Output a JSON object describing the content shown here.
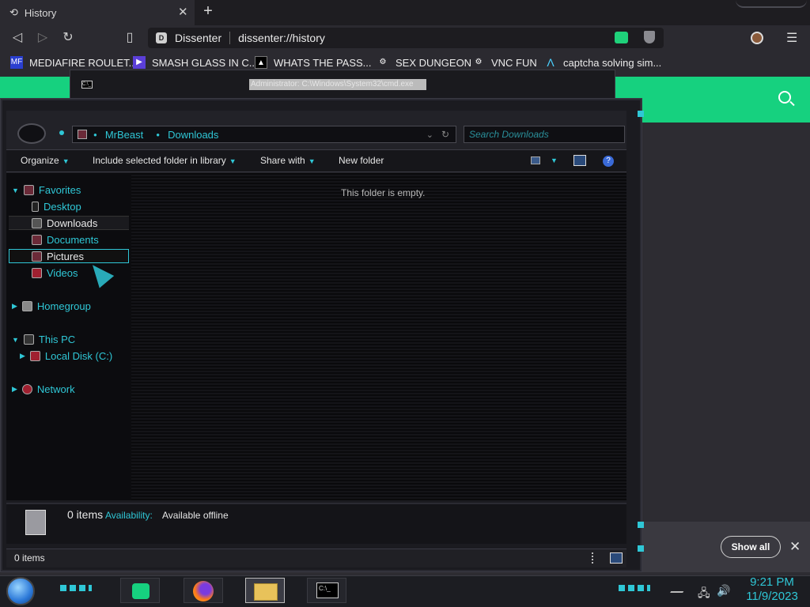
{
  "browser": {
    "tab_title": "History",
    "tab_close": "✕",
    "new_tab": "+",
    "address": {
      "site": "Dissenter",
      "url": "dissenter://history"
    },
    "menu": "☰",
    "bookmarks": [
      {
        "label": "MEDIAFIRE ROULET...",
        "icon": "mediafire-icon"
      },
      {
        "label": "SMASH GLASS IN C...",
        "icon": "visual-studio-icon"
      },
      {
        "label": "WHATS THE PASS...",
        "icon": "ghost-icon"
      },
      {
        "label": "SEX DUNGEON",
        "icon": "gear-icon"
      },
      {
        "label": "VNC FUN",
        "icon": "gear-icon"
      },
      {
        "label": "captcha solving sim...",
        "icon": "lambda-icon"
      }
    ]
  },
  "page": {
    "accent_color": "#16d17f",
    "show_all_label": "Show all"
  },
  "cmd_window": {
    "title": "Administrator: C:\\Windows\\System32\\cmd.exe",
    "icon_text": "C:\\_"
  },
  "explorer": {
    "breadcrumb": [
      "MrBeast",
      "Downloads"
    ],
    "search_placeholder": "Search Downloads",
    "commands": {
      "organize": "Organize",
      "include": "Include selected folder in library",
      "share": "Share with",
      "new_folder": "New folder"
    },
    "nav": {
      "favorites": "Favorites",
      "desktop": "Desktop",
      "downloads": "Downloads",
      "documents": "Documents",
      "pictures": "Pictures",
      "videos": "Videos",
      "homegroup": "Homegroup",
      "this_pc": "This PC",
      "local_disk": "Local Disk (C:)",
      "network": "Network"
    },
    "empty_message": "This folder is empty.",
    "details": {
      "count": "0 items",
      "availability_label": "Availability:",
      "availability_value": "Available offline"
    },
    "status_count": "0 items",
    "accent_color": "#2fc7d6"
  },
  "taskbar": {
    "time": "9:21 PM",
    "date": "11/9/2023",
    "cmd_icon_text": "C:\\_"
  }
}
